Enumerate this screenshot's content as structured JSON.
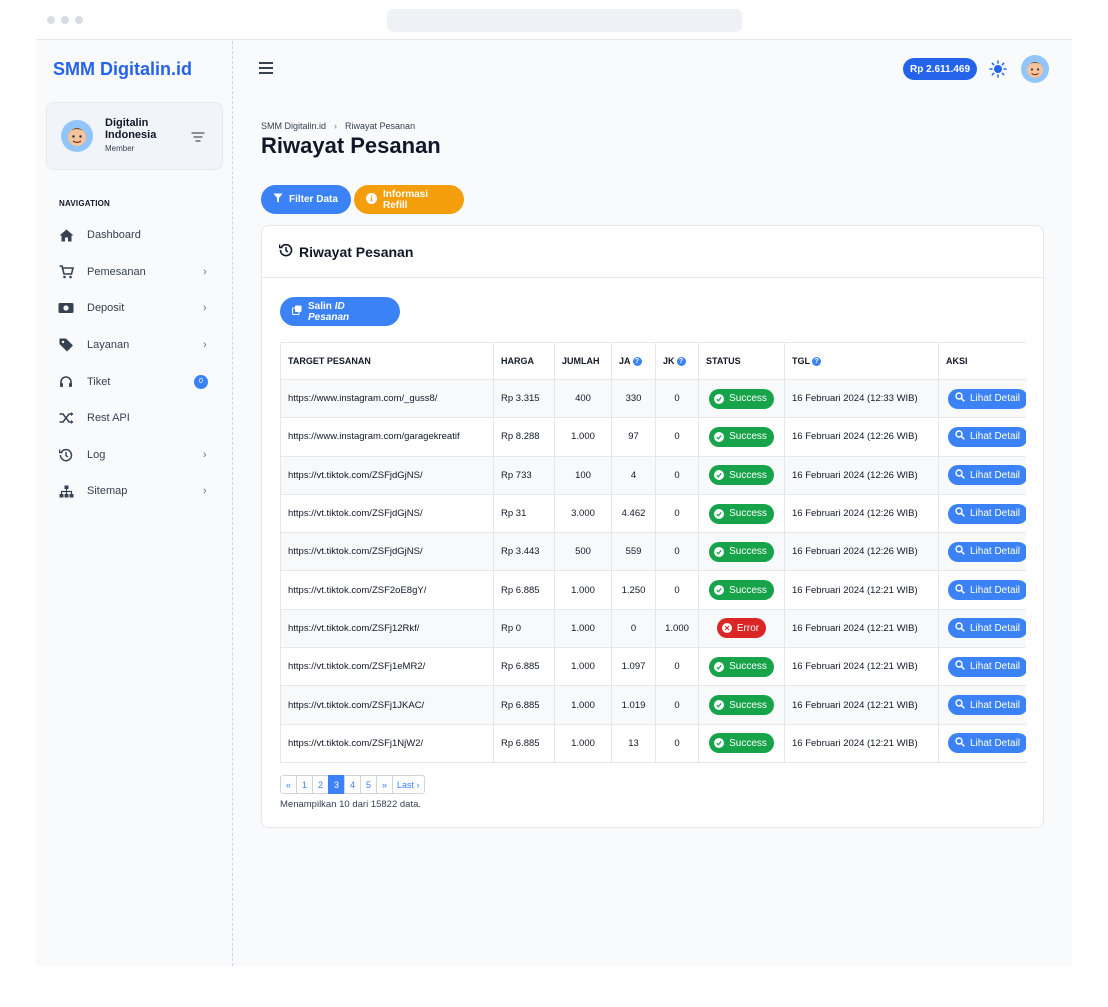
{
  "brand": "SMM Digitalin.id",
  "user": {
    "name": "Digitalin Indonesia",
    "role": "Member"
  },
  "nav": {
    "section": "NAVIGATION",
    "items": [
      {
        "label": "Dashboard",
        "icon": "home-icon",
        "chevron": false
      },
      {
        "label": "Pemesanan",
        "icon": "cart-icon",
        "chevron": true
      },
      {
        "label": "Deposit",
        "icon": "money-icon",
        "chevron": true
      },
      {
        "label": "Layanan",
        "icon": "tag-icon",
        "chevron": true
      },
      {
        "label": "Tiket",
        "icon": "headset-icon",
        "chevron": false,
        "badge": "0"
      },
      {
        "label": "Rest API",
        "icon": "shuffle-icon",
        "chevron": false
      },
      {
        "label": "Log",
        "icon": "history-icon",
        "chevron": true
      },
      {
        "label": "Sitemap",
        "icon": "sitemap-icon",
        "chevron": true
      }
    ]
  },
  "topbar": {
    "balance": "Rp 2.611.469"
  },
  "breadcrumb": {
    "root": "SMM Digitalin.id",
    "sep": "›",
    "current": "Riwayat Pesanan"
  },
  "page_title": "Riwayat Pesanan",
  "actions": {
    "filter": "Filter Data",
    "refill": "Informasi Refill"
  },
  "card": {
    "title": "Riwayat Pesanan",
    "copy_prefix": "Salin",
    "copy_em": "ID Pesanan"
  },
  "table": {
    "headers": [
      "TARGET PESANAN",
      "HARGA",
      "JUMLAH",
      "JA",
      "JK",
      "STATUS",
      "TGL",
      "AKSI"
    ],
    "rows": [
      [
        "https://www.instagram.com/_guss8/",
        "Rp 3.315",
        "400",
        "330",
        "0",
        "Success",
        "16 Februari 2024 (12:33 WIB)",
        "Lihat Detail"
      ],
      [
        "https://www.instagram.com/garagekreatif",
        "Rp 8.288",
        "1.000",
        "97",
        "0",
        "Success",
        "16 Februari 2024 (12:26 WIB)",
        "Lihat Detail"
      ],
      [
        "https://vt.tiktok.com/ZSFjdGjNS/",
        "Rp 733",
        "100",
        "4",
        "0",
        "Success",
        "16 Februari 2024 (12:26 WIB)",
        "Lihat Detail"
      ],
      [
        "https://vt.tiktok.com/ZSFjdGjNS/",
        "Rp 31",
        "3.000",
        "4.462",
        "0",
        "Success",
        "16 Februari 2024 (12:26 WIB)",
        "Lihat Detail"
      ],
      [
        "https://vt.tiktok.com/ZSFjdGjNS/",
        "Rp 3.443",
        "500",
        "559",
        "0",
        "Success",
        "16 Februari 2024 (12:26 WIB)",
        "Lihat Detail"
      ],
      [
        "https://vt.tiktok.com/ZSF2oE8gY/",
        "Rp 6.885",
        "1.000",
        "1.250",
        "0",
        "Success",
        "16 Februari 2024 (12:21 WIB)",
        "Lihat Detail"
      ],
      [
        "https://vt.tiktok.com/ZSFj12Rkf/",
        "Rp 0",
        "1.000",
        "0",
        "1.000",
        "Error",
        "16 Februari 2024 (12:21 WIB)",
        "Lihat Detail"
      ],
      [
        "https://vt.tiktok.com/ZSFj1eMR2/",
        "Rp 6.885",
        "1.000",
        "1.097",
        "0",
        "Success",
        "16 Februari 2024 (12:21 WIB)",
        "Lihat Detail"
      ],
      [
        "https://vt.tiktok.com/ZSFj1JKAC/",
        "Rp 6.885",
        "1.000",
        "1.019",
        "0",
        "Success",
        "16 Februari 2024 (12:21 WIB)",
        "Lihat Detail"
      ],
      [
        "https://vt.tiktok.com/ZSFj1NjW2/",
        "Rp 6.885",
        "1.000",
        "13",
        "0",
        "Success",
        "16 Februari 2024 (12:21 WIB)",
        "Lihat Detail"
      ]
    ]
  },
  "pagination": {
    "pages": [
      "«",
      "1",
      "2",
      "3",
      "4",
      "5",
      "»",
      "Last ›"
    ],
    "active": "3"
  },
  "page_info": "Menampilkan 10 dari 15822 data.",
  "colors": {
    "primary": "#3b82f6",
    "brand": "#2563eb",
    "warning": "#f59e0b",
    "success": "#16a34a",
    "danger": "#dc2626"
  }
}
